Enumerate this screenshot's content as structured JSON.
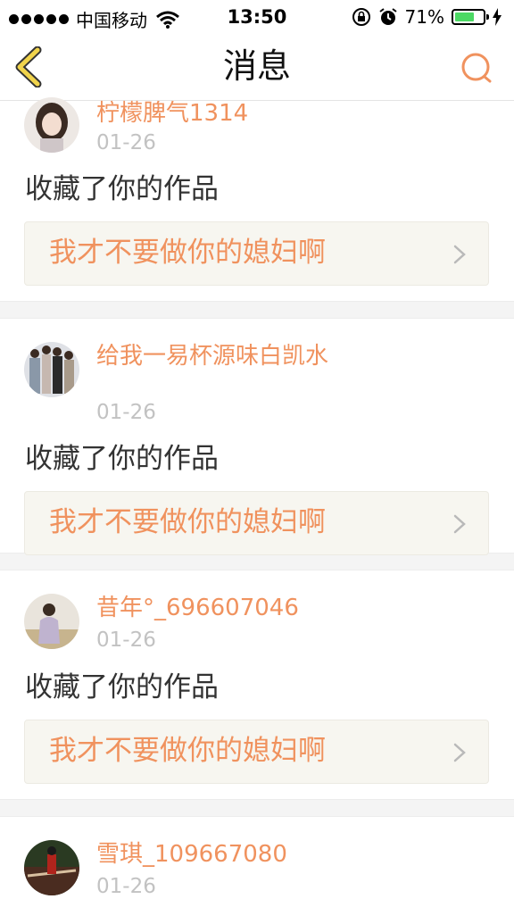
{
  "status_bar": {
    "carrier": "中国移动",
    "time": "13:50",
    "battery_percent_text": "71%",
    "battery_level": 0.71,
    "icons": [
      "signal-dots-icon",
      "wifi-icon",
      "orientation-lock-icon",
      "alarm-icon",
      "battery-icon",
      "charging-icon"
    ]
  },
  "nav": {
    "title": "消息",
    "back_icon": "chevron-left-icon",
    "search_icon": "search-icon"
  },
  "colors": {
    "accent": "#f0925e",
    "back_yellow": "#f1d44c",
    "date_gray": "#c2c2c2",
    "card_bg": "#f7f6f0",
    "separator": "#f4f4f4"
  },
  "messages": [
    {
      "user": "柠檬脾气1314",
      "date": "01-26",
      "action": "收藏了你的作品",
      "work": "我才不要做你的媳妇啊"
    },
    {
      "user": "给我一易杯源味白凯水",
      "date": "01-26",
      "action": "收藏了你的作品",
      "work": "我才不要做你的媳妇啊"
    },
    {
      "user": "昔年°_696607046",
      "date": "01-26",
      "action": "收藏了你的作品",
      "work": "我才不要做你的媳妇啊"
    },
    {
      "user": "雪琪_109667080",
      "date": "01-26",
      "action": "",
      "work": ""
    }
  ]
}
